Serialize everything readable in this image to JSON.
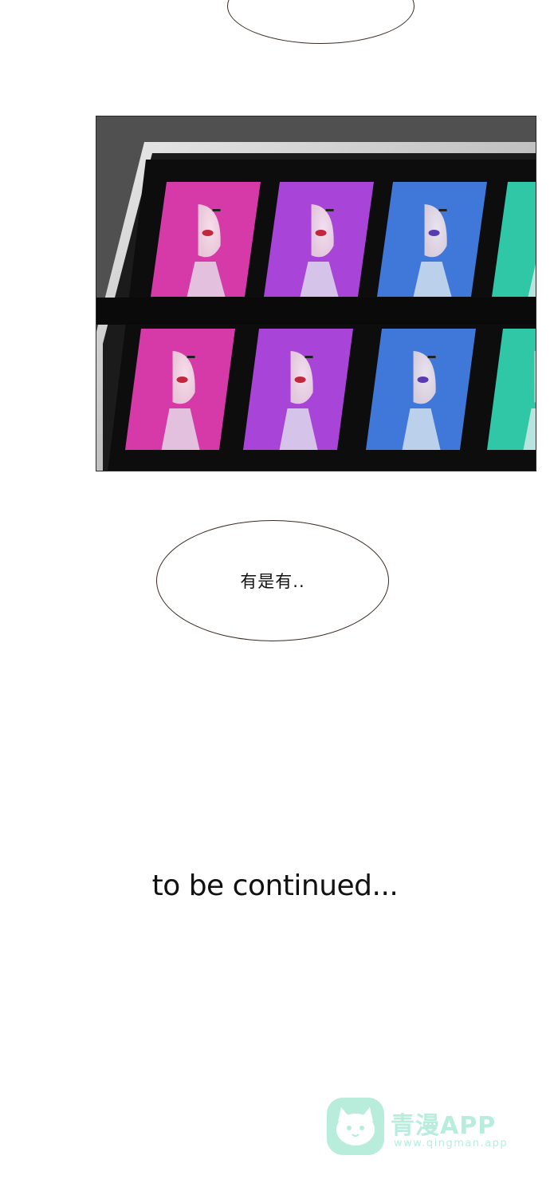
{
  "dialogue": {
    "bubble_mid_text": "有是有.."
  },
  "ending": {
    "text": "to be continued..."
  },
  "watermark": {
    "name": "青漫APP",
    "url": "www.qingman.app"
  },
  "panel": {
    "portrait_colors": [
      "#d63aa8",
      "#a845d8",
      "#3f78d8",
      "#2fc7a6"
    ]
  }
}
